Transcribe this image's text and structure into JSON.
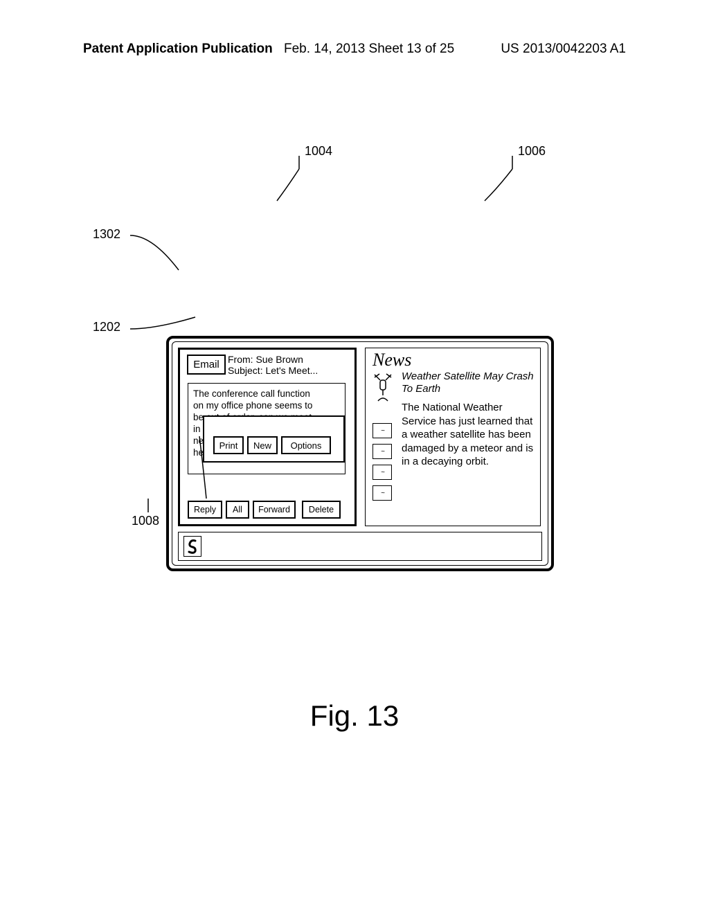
{
  "header": {
    "left": "Patent Application Publication",
    "center": "Feb. 14, 2013  Sheet 13 of 25",
    "right": "US 2013/0042203 A1"
  },
  "figure_label": "Fig. 13",
  "refs": {
    "r1004": "1004",
    "r1006": "1006",
    "r1008": "1008",
    "r1202": "1202",
    "r1302": "1302"
  },
  "email": {
    "chip": "Email",
    "from": "From: Sue Brown",
    "subject": "Subject: Let's Meet...",
    "body_lines": [
      "The conference call function",
      "on my office phone seems to",
      "be out of order, can we meet",
      "in",
      "new",
      "her"
    ],
    "popup_title": "",
    "popup_buttons": {
      "print": "Print",
      "newmsg": "New",
      "options": "Options"
    },
    "actions": {
      "reply": "Reply",
      "all": "All",
      "forward": "Forward",
      "del": "Delete"
    }
  },
  "news": {
    "title": "News",
    "headline": "Weather Satellite May Crash To Earth",
    "body": "The National Weather Service has just learned that a weather satellite has been damaged by a meteor and is in a decaying orbit."
  },
  "bottombar": {
    "start_glyph": "S"
  }
}
